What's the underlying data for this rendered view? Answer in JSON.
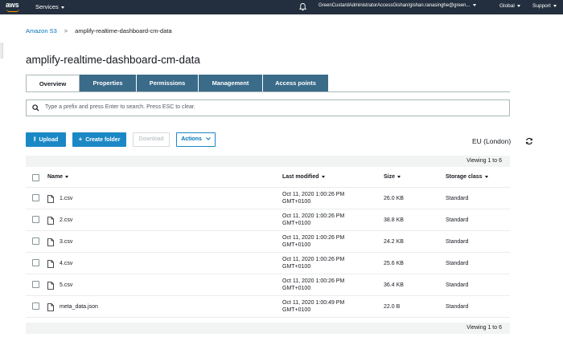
{
  "nav": {
    "logo": "aws",
    "services": "Services",
    "account": "GreenCustardAdministratorAccessGishan/gishan.ranasinghe@green...",
    "region": "Global",
    "support": "Support"
  },
  "breadcrumb": {
    "root": "Amazon S3",
    "separator": ">",
    "current": "amplify-realtime-dashboard-cm-data"
  },
  "page_title": "amplify-realtime-dashboard-cm-data",
  "tabs": [
    {
      "label": "Overview",
      "active": true
    },
    {
      "label": "Properties",
      "active": false
    },
    {
      "label": "Permissions",
      "active": false
    },
    {
      "label": "Management",
      "active": false
    },
    {
      "label": "Access points",
      "active": false
    }
  ],
  "search": {
    "placeholder": "Type a prefix and press Enter to search. Press ESC to clear."
  },
  "actions": {
    "upload": "Upload",
    "create_folder": "Create folder",
    "download": "Download",
    "actions": "Actions"
  },
  "region_label": "EU (London)",
  "viewing": "Viewing 1 to 6",
  "columns": {
    "name": "Name",
    "last_modified": "Last modified",
    "size": "Size",
    "storage_class": "Storage class"
  },
  "rows": [
    {
      "name": "1.csv",
      "modified": "Oct 11, 2020 1:00:26 PM",
      "tz": "GMT+0100",
      "size": "26.0 KB",
      "storage": "Standard"
    },
    {
      "name": "2.csv",
      "modified": "Oct 11, 2020 1:00:26 PM",
      "tz": "GMT+0100",
      "size": "38.8 KB",
      "storage": "Standard"
    },
    {
      "name": "3.csv",
      "modified": "Oct 11, 2020 1:00:26 PM",
      "tz": "GMT+0100",
      "size": "24.2 KB",
      "storage": "Standard"
    },
    {
      "name": "4.csv",
      "modified": "Oct 11, 2020 1:00:26 PM",
      "tz": "GMT+0100",
      "size": "25.6 KB",
      "storage": "Standard"
    },
    {
      "name": "5.csv",
      "modified": "Oct 11, 2020 1:00:26 PM",
      "tz": "GMT+0100",
      "size": "36.4 KB",
      "storage": "Standard"
    },
    {
      "name": "meta_data.json",
      "modified": "Oct 11, 2020 1:00:49 PM",
      "tz": "GMT+0100",
      "size": "22.0 B",
      "storage": "Standard"
    }
  ],
  "colors": {
    "nav_bg": "#232f3e",
    "tab_bg": "#3a6b89",
    "primary_button": "#1b88c6",
    "link": "#0073bb"
  }
}
